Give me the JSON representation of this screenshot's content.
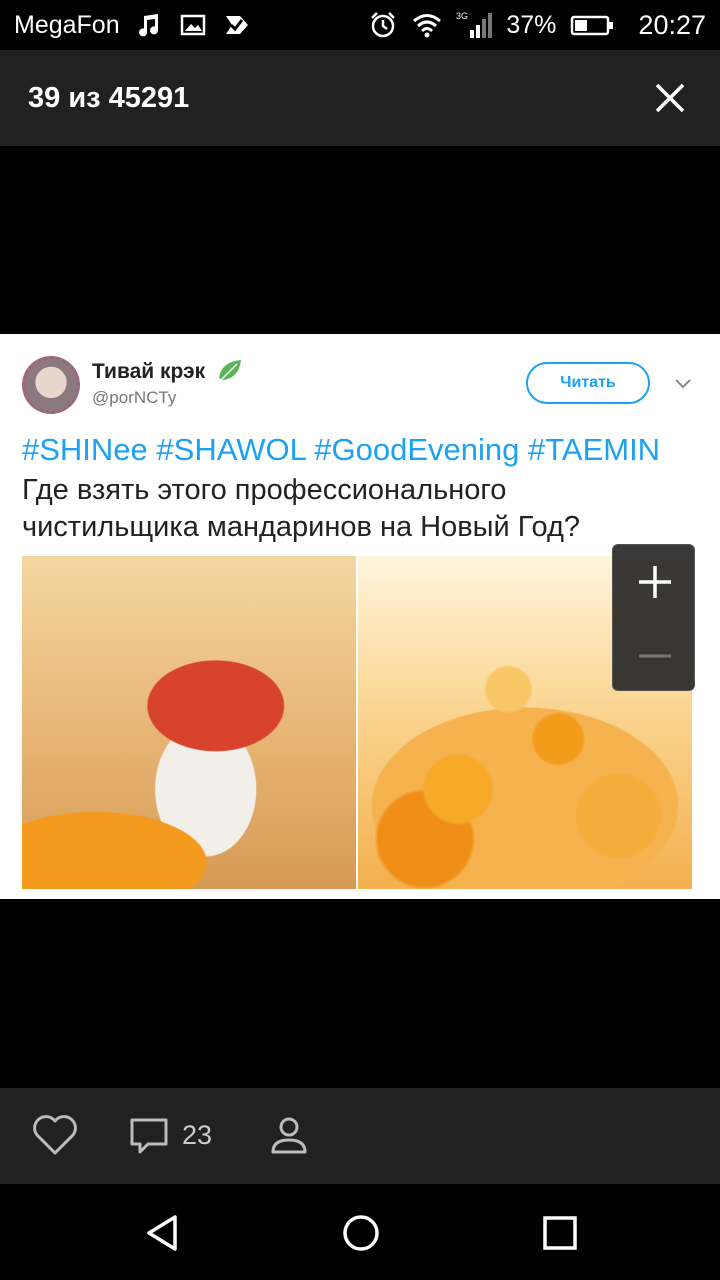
{
  "status_bar": {
    "carrier": "MegaFon",
    "network": "3G",
    "battery_percent": "37%",
    "time": "20:27",
    "icons": [
      "music-icon",
      "image-icon",
      "check-icon",
      "alarm-icon",
      "wifi-icon",
      "signal-icon",
      "battery-icon"
    ]
  },
  "viewer": {
    "counter": "39 из 45291",
    "close_icon": "close-icon"
  },
  "photo": {
    "author_name": "Тивай крэк",
    "author_handle": "@porNCTy",
    "follow_label": "Читать",
    "hashtags": "#SHINee #SHAWOL #GoodEvening #TAEMIN",
    "text_line1": "Где взять этого профессионального",
    "text_line2": "чистильщика мандаринов на Новый Год?",
    "accent_color": "#1da1f2"
  },
  "zoom": {
    "in_icon": "plus-icon",
    "out_icon": "minus-icon"
  },
  "actions": {
    "like_icon": "heart-icon",
    "comment_icon": "comment-icon",
    "comment_count": "23",
    "tag_icon": "person-icon"
  },
  "nav": {
    "back_icon": "back-triangle-icon",
    "home_icon": "home-circle-icon",
    "recent_icon": "recent-square-icon"
  }
}
